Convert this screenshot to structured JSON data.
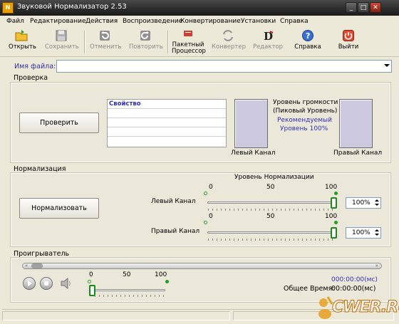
{
  "window": {
    "title": "Звуковой Нормализатор 2.53",
    "app_icon_text": "N"
  },
  "menu": [
    "Файл",
    "Редактирование",
    "Действия",
    "Воспроизведение",
    "Конвертирование",
    "Установки",
    "Справка"
  ],
  "toolbar": {
    "open": "Открыть",
    "save": "Сохранить",
    "undo": "Отменить",
    "redo": "Повторить",
    "batch_line1": "Пакетный",
    "batch_line2": "Процессор",
    "convert": "Конвертер",
    "editor": "Редактор",
    "help": "Справка",
    "exit": "Выйти"
  },
  "file": {
    "label": "Имя файла:",
    "value": ""
  },
  "check": {
    "title": "Проверка",
    "button": "Проверить",
    "grid_header": "Свойство",
    "level_line1": "Уровень громкости",
    "level_line2": "(Пиковый Уровень)",
    "recommended_line1": "Рекомендуемый",
    "recommended_line2": "Уровень 100%",
    "left_channel": "Левый Канал",
    "right_channel": "Правый Канал"
  },
  "normalize": {
    "title": "Нормализация",
    "button": "Нормализовать",
    "heading": "Уровень Нормализации",
    "scale": [
      "0",
      "50",
      "100"
    ],
    "left_label": "Левый Канал",
    "right_label": "Правый Канал",
    "left_value": "100%",
    "right_value": "100%",
    "left_level": 1.0,
    "right_level": 1.0
  },
  "player": {
    "title": "Проигрыватель",
    "volume_scale": [
      "0",
      "50",
      "100"
    ],
    "volume_level": 0.0,
    "seek_position": 0.0,
    "current_time": "000:00:00(мс)",
    "total_label": "Общее Время:",
    "total_time": "00:00:00(мс)"
  },
  "watermark": "CWER.RU",
  "colors": {
    "accent_blue": "#3030c0",
    "slider_green": "#1a8a1a",
    "meter_fill": "#ccc9e0",
    "title_bar": "#2a2a2a"
  }
}
